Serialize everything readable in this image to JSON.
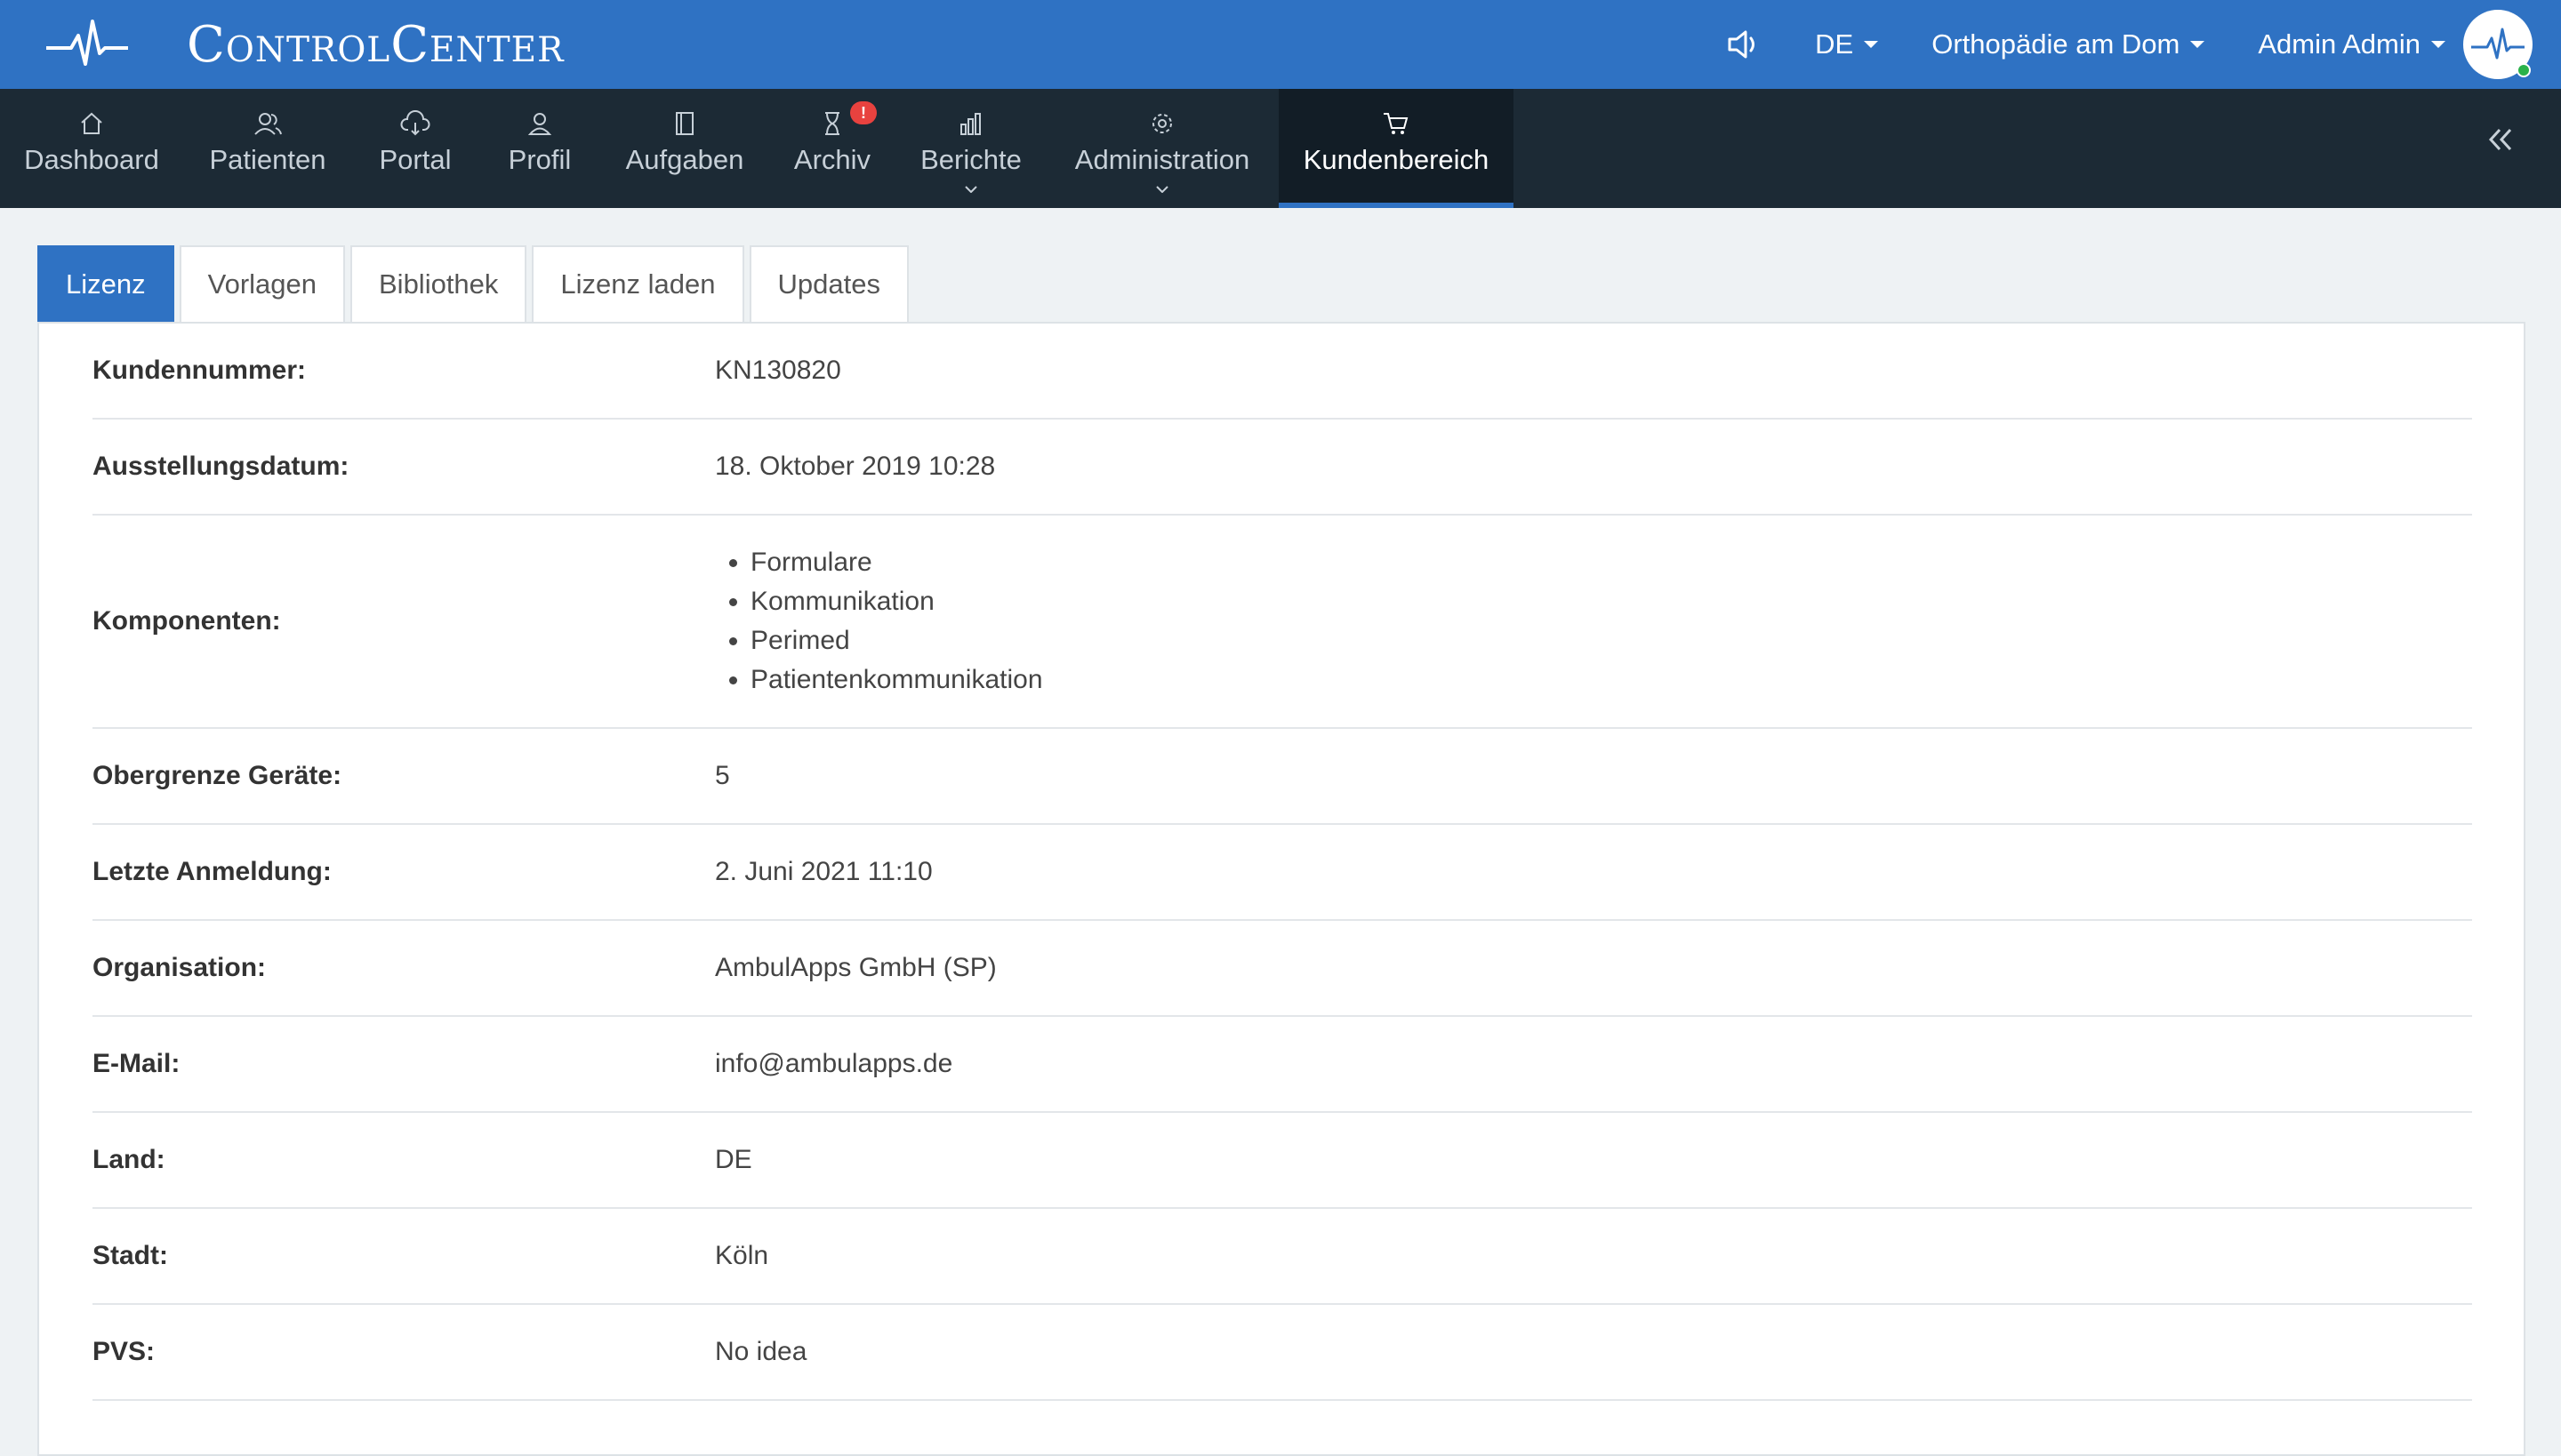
{
  "app": {
    "title": "ControlCenter"
  },
  "topbar": {
    "language": "DE",
    "practice": "Orthopädie am Dom",
    "user": "Admin Admin",
    "accent_color": "#2f72c3"
  },
  "nav": {
    "items": [
      {
        "label": "Dashboard",
        "icon": "home-icon"
      },
      {
        "label": "Patienten",
        "icon": "users-icon"
      },
      {
        "label": "Portal",
        "icon": "cloud-icon"
      },
      {
        "label": "Profil",
        "icon": "user-icon"
      },
      {
        "label": "Aufgaben",
        "icon": "notebook-icon"
      },
      {
        "label": "Archiv",
        "icon": "hourglass-icon",
        "badge": "!"
      },
      {
        "label": "Berichte",
        "icon": "bar-chart-icon"
      },
      {
        "label": "Administration",
        "icon": "gear-icon"
      },
      {
        "label": "Kundenbereich",
        "icon": "cart-icon",
        "active": true
      }
    ]
  },
  "tabs": [
    "Lizenz",
    "Vorlagen",
    "Bibliothek",
    "Lizenz laden",
    "Updates"
  ],
  "license": {
    "rows": [
      {
        "label": "Kundennummer:",
        "value": "KN130820"
      },
      {
        "label": "Ausstellungsdatum:",
        "value": "18. Oktober 2019 10:28"
      },
      {
        "label": "Komponenten:",
        "items": [
          "Formulare",
          "Kommunikation",
          "Perimed",
          "Patientenkommunikation"
        ]
      },
      {
        "label": "Obergrenze Geräte:",
        "value": "5"
      },
      {
        "label": "Letzte Anmeldung:",
        "value": "2. Juni 2021 11:10"
      },
      {
        "label": "Organisation:",
        "value": "AmbulApps GmbH (SP)"
      },
      {
        "label": "E-Mail:",
        "value": "info@ambulapps.de"
      },
      {
        "label": "Land:",
        "value": "DE"
      },
      {
        "label": "Stadt:",
        "value": "Köln"
      },
      {
        "label": "PVS:",
        "value": "No idea"
      }
    ]
  }
}
